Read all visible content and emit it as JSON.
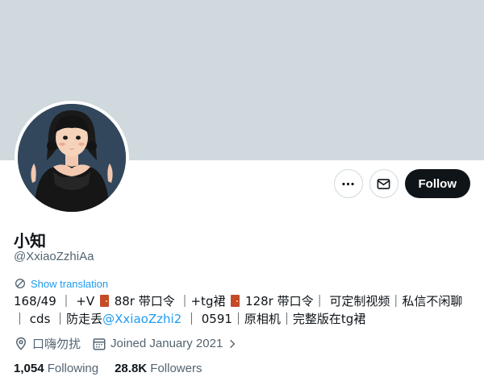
{
  "profile": {
    "name": "小知",
    "handle": "@XxiaoZzhiAa",
    "show_translation": "Show translation",
    "bio": {
      "p1": "168/49 ｜ +V",
      "p2": "88r 带口令 ｜+tg裙",
      "p3": "128r 带口令｜ 可定制视频｜私信不闲聊｜",
      "p4": "cds ｜防走丢",
      "mention": "@XxiaoZzhi2",
      "p5": " ｜ 0591｜原相机｜完整版在tg裙"
    },
    "location": "口嗨勿扰",
    "joined": "Joined January 2021",
    "following_count": "1,054",
    "following_label": "Following",
    "followers_count": "28.8K",
    "followers_label": "Followers"
  },
  "actions": {
    "follow_label": "Follow",
    "more_icon": "more-icon",
    "message_icon": "envelope-icon"
  },
  "colors": {
    "banner": "#cfd9de",
    "accent": "#1d9bf0",
    "text": "#0f1419",
    "secondary": "#536471"
  }
}
